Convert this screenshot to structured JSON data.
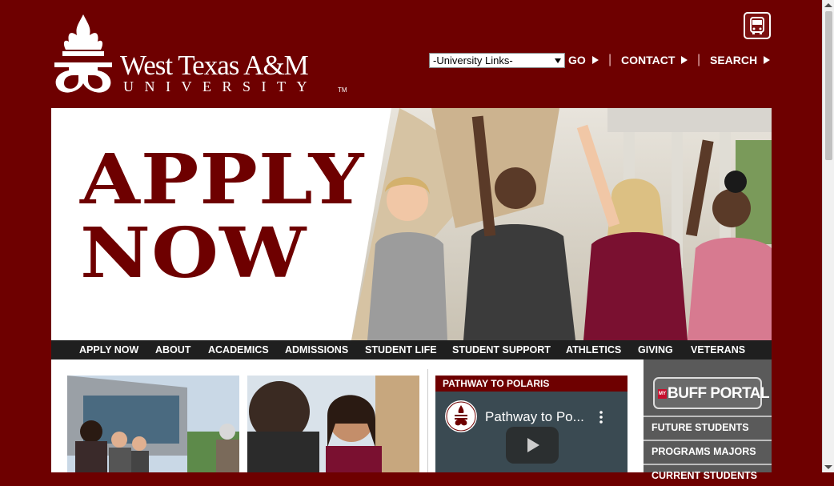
{
  "header": {
    "logo_wordmark": "West Texas A&M",
    "logo_university": "UNIVERSITY",
    "logo_tm": "TM",
    "links_select_value": "-University Links-",
    "go_label": "GO",
    "contact_label": "CONTACT",
    "search_label": "SEARCH",
    "separator": "|"
  },
  "hero": {
    "line1": "APPLY",
    "line2": "NOW"
  },
  "nav": {
    "items": [
      "APPLY NOW",
      "ABOUT",
      "ACADEMICS",
      "ADMISSIONS",
      "STUDENT LIFE",
      "STUDENT SUPPORT",
      "ATHLETICS",
      "GIVING",
      "VETERANS"
    ]
  },
  "pathway": {
    "heading": "PATHWAY TO POLARIS",
    "video_title": "Pathway to Po..."
  },
  "sidebar": {
    "portal_badge": "MY",
    "portal_label": "BUFF PORTAL",
    "links": [
      "FUTURE STUDENTS",
      "PROGRAMS MAJORS",
      "CURRENT STUDENTS"
    ]
  },
  "colors": {
    "brand": "#6e0000",
    "nav_bg": "#1f1f1f",
    "sidebar_bg": "#5a5a5a"
  },
  "icons": [
    "bus-icon",
    "chevron-right-icon",
    "dropdown-caret-icon",
    "play-icon",
    "kebab-menu-icon"
  ]
}
